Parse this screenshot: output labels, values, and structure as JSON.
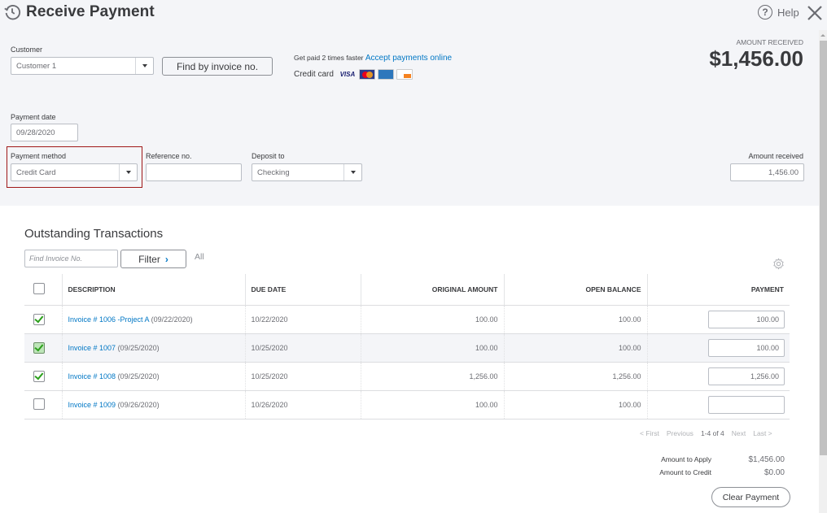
{
  "header": {
    "title": "Receive Payment",
    "help_label": "Help",
    "amount_received_caption": "AMOUNT RECEIVED",
    "amount_received_total": "$1,456.00"
  },
  "customer": {
    "label": "Customer",
    "value": "Customer 1",
    "find_button": "Find by invoice no."
  },
  "promo": {
    "text": "Get paid 2 times faster",
    "link": "Accept payments online",
    "credit_card_label": "Credit card",
    "cards": [
      "VISA",
      "MasterCard",
      "American Express",
      "Discover"
    ],
    "visa_text": "VISA"
  },
  "payment_date": {
    "label": "Payment date",
    "value": "09/28/2020"
  },
  "payment_method": {
    "label": "Payment method",
    "value": "Credit Card"
  },
  "reference": {
    "label": "Reference no.",
    "value": ""
  },
  "deposit_to": {
    "label": "Deposit to",
    "value": "Checking"
  },
  "amount_received": {
    "label": "Amount received",
    "value": "1,456.00"
  },
  "outstanding": {
    "title": "Outstanding Transactions",
    "find_placeholder": "Find Invoice No.",
    "filter_label": "Filter",
    "filter_chevron": "›",
    "filter_status": "All",
    "columns": [
      "DESCRIPTION",
      "DUE DATE",
      "ORIGINAL AMOUNT",
      "OPEN BALANCE",
      "PAYMENT"
    ],
    "rows": [
      {
        "checked": true,
        "invoice": "Invoice # 1006 -Project A",
        "date": "(09/22/2020)",
        "due_date": "10/22/2020",
        "original": "100.00",
        "open_balance": "100.00",
        "payment": "100.00"
      },
      {
        "checked": true,
        "invoice": "Invoice # 1007",
        "date": "(09/25/2020)",
        "due_date": "10/25/2020",
        "original": "100.00",
        "open_balance": "100.00",
        "payment": "100.00"
      },
      {
        "checked": true,
        "invoice": "Invoice # 1008",
        "date": "(09/25/2020)",
        "due_date": "10/25/2020",
        "original": "1,256.00",
        "open_balance": "1,256.00",
        "payment": "1,256.00"
      },
      {
        "checked": false,
        "invoice": "Invoice # 1009",
        "date": "(09/26/2020)",
        "due_date": "10/26/2020",
        "original": "100.00",
        "open_balance": "100.00",
        "payment": ""
      }
    ]
  },
  "pager": {
    "first": "< First",
    "previous": "Previous",
    "range": "1-4 of 4",
    "next": "Next",
    "last": "Last >"
  },
  "summary": {
    "apply_label": "Amount to Apply",
    "apply_value": "$1,456.00",
    "credit_label": "Amount to Credit",
    "credit_value": "$0.00",
    "clear_button": "Clear Payment"
  },
  "colors": {
    "link": "#0077c5",
    "check": "#2ca01c",
    "highlight_border": "#a01818",
    "panel_bg": "#f4f5f8"
  }
}
